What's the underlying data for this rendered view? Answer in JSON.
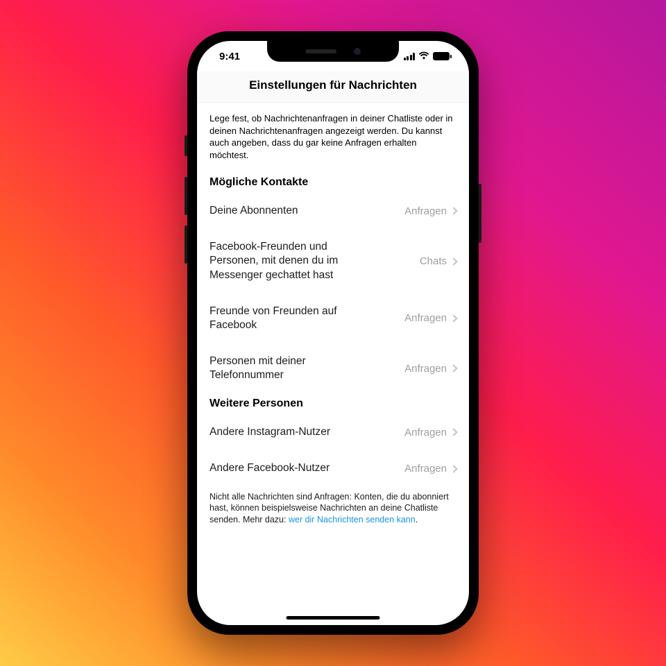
{
  "status": {
    "time": "9:41"
  },
  "header": {
    "title": "Einstellungen für Nachrichten"
  },
  "intro": "Lege fest, ob Nachrichtenanfragen in deiner Chatliste oder in deinen Nachrichtenanfragen angezeigt werden. Du kannst auch angeben, dass du gar keine Anfragen erhalten möchtest.",
  "sections": [
    {
      "title": "Mögliche Kontakte",
      "items": [
        {
          "label": "Deine Abonnenten",
          "value": "Anfragen"
        },
        {
          "label": "Facebook-Freunden und Personen, mit denen du im Messenger gechattet hast",
          "value": "Chats"
        },
        {
          "label": "Freunde von Freunden auf Facebook",
          "value": "Anfragen"
        },
        {
          "label": "Personen mit deiner Telefonnummer",
          "value": "Anfragen"
        }
      ]
    },
    {
      "title": "Weitere Personen",
      "items": [
        {
          "label": "Andere Instagram-Nutzer",
          "value": "Anfragen"
        },
        {
          "label": "Andere Facebook-Nutzer",
          "value": "Anfragen"
        }
      ]
    }
  ],
  "footer": {
    "text": "Nicht alle Nachrichten sind Anfragen: Konten, die du abonniert hast, können beispielsweise Nachrichten an deine Chatliste senden. Mehr dazu: ",
    "link": "wer dir Nachrichten senden kann",
    "suffix": "."
  }
}
